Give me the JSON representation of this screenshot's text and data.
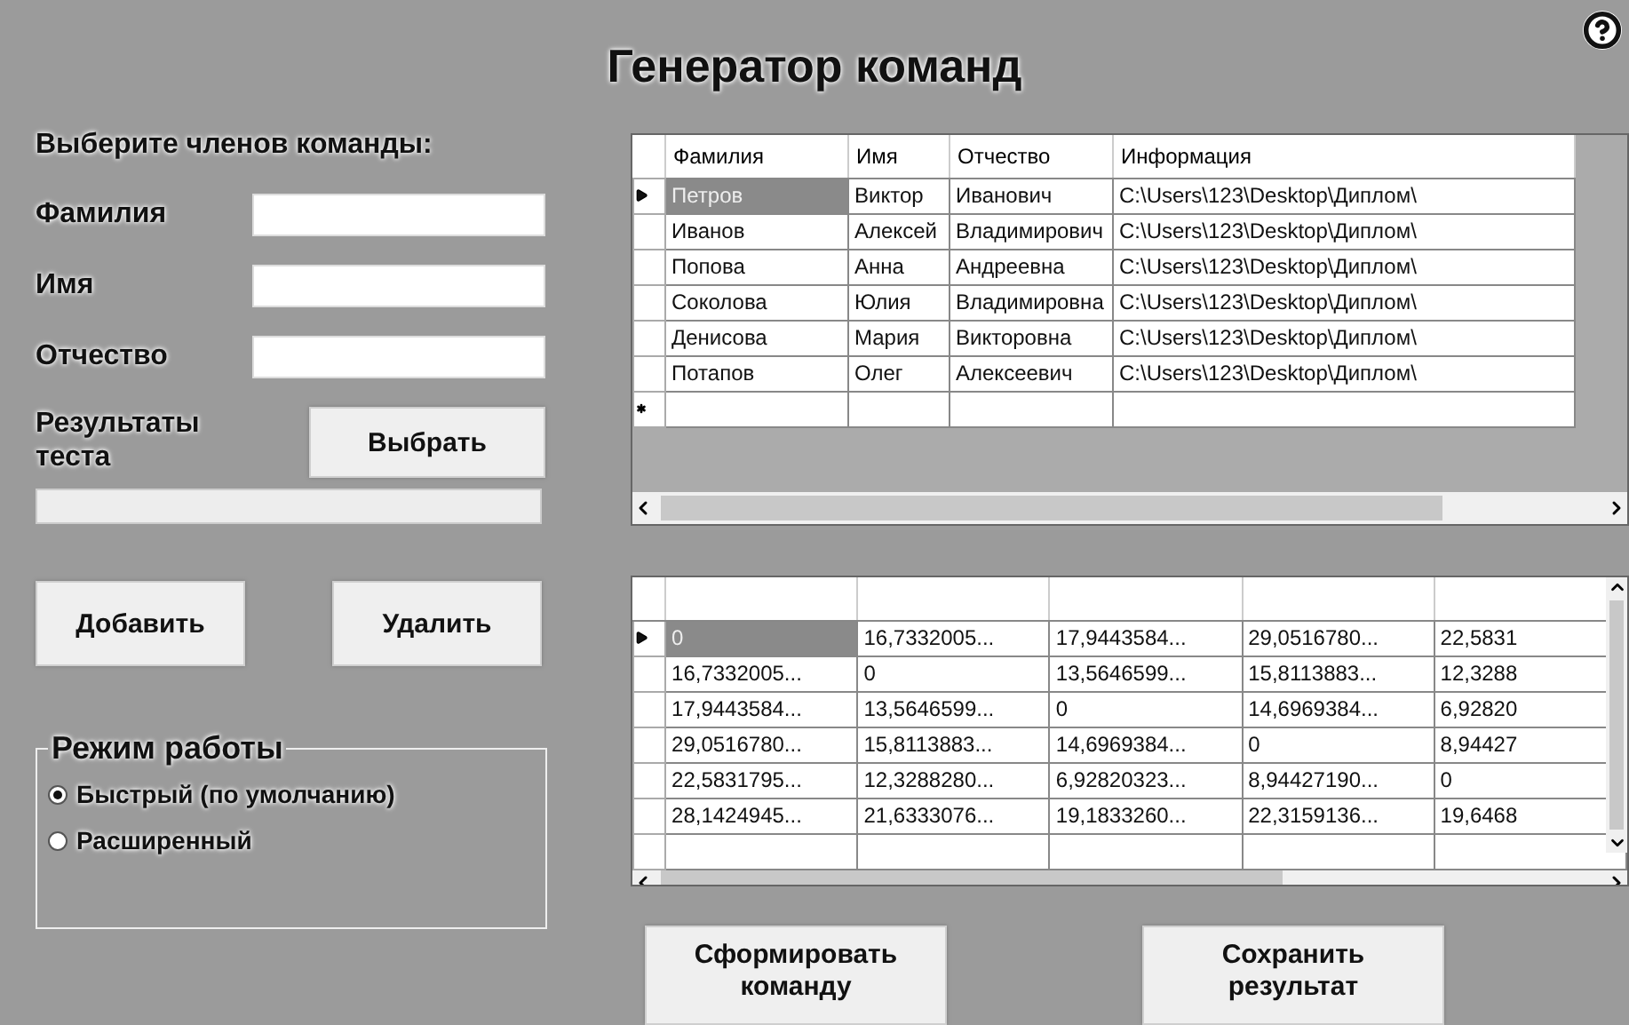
{
  "title": "Генератор команд",
  "selection": {
    "heading": "Выберите членов команды:",
    "fields": [
      {
        "label": "Фамилия"
      },
      {
        "label": "Имя"
      },
      {
        "label": "Отчество"
      }
    ],
    "results_label": "Результаты теста",
    "choose_button": "Выбрать"
  },
  "actions": [
    "Добавить",
    "Удалить"
  ],
  "mode": {
    "legend": "Режим работы",
    "options": [
      {
        "label": "Быстрый (по умолчанию)",
        "selected": true
      },
      {
        "label": "Расширенный",
        "selected": false
      }
    ]
  },
  "members_table": {
    "columns": [
      "Фамилия",
      "Имя",
      "Отчество",
      "Информация"
    ],
    "rows": [
      {
        "cells": [
          "Петров",
          "Виктор",
          "Иванович",
          "C:\\Users\\123\\Desktop\\Диплом\\"
        ],
        "current": true
      },
      {
        "cells": [
          "Иванов",
          "Алексей",
          "Владимирович",
          "C:\\Users\\123\\Desktop\\Диплом\\"
        ],
        "current": false
      },
      {
        "cells": [
          "Попова",
          "Анна",
          "Андреевна",
          "C:\\Users\\123\\Desktop\\Диплом\\"
        ],
        "current": false
      },
      {
        "cells": [
          "Соколова",
          "Юлия",
          "Владимировна",
          "C:\\Users\\123\\Desktop\\Диплом\\"
        ],
        "current": false
      },
      {
        "cells": [
          "Денисова",
          "Мария",
          "Викторовна",
          "C:\\Users\\123\\Desktop\\Диплом\\"
        ],
        "current": false
      },
      {
        "cells": [
          "Потапов",
          "Олег",
          "Алексеевич",
          "C:\\Users\\123\\Desktop\\Диплом\\"
        ],
        "current": false
      }
    ]
  },
  "distance_table": {
    "rows": [
      {
        "cells": [
          "0",
          "16,7332005...",
          "17,9443584...",
          "29,0516780...",
          "22,5831"
        ],
        "current": true
      },
      {
        "cells": [
          "16,7332005...",
          "0",
          "13,5646599...",
          "15,8113883...",
          "12,3288"
        ],
        "current": false
      },
      {
        "cells": [
          "17,9443584...",
          "13,5646599...",
          "0",
          "14,6969384...",
          "6,92820"
        ],
        "current": false
      },
      {
        "cells": [
          "29,0516780...",
          "15,8113883...",
          "14,6969384...",
          "0",
          "8,94427"
        ],
        "current": false
      },
      {
        "cells": [
          "22,5831795...",
          "12,3288280...",
          "6,92820323...",
          "8,94427190...",
          "0"
        ],
        "current": false
      },
      {
        "cells": [
          "28,1424945...",
          "21,6333076...",
          "19,1833260...",
          "22,3159136...",
          "19,6468"
        ],
        "current": false
      }
    ]
  },
  "bottom_buttons": [
    "Сформировать команду",
    "Сохранить результат"
  ]
}
